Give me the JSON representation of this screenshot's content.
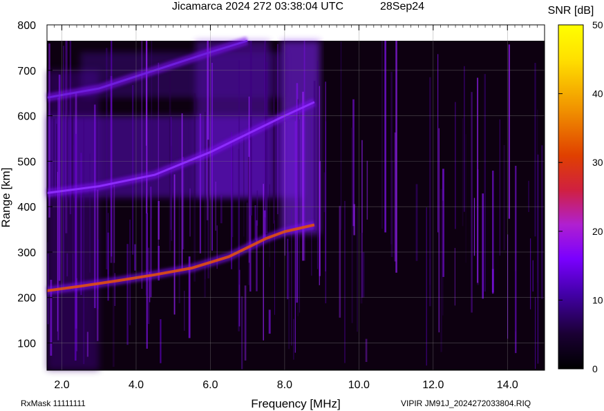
{
  "header": {
    "title": "Jicamarca 2024 272 03:38:04 UTC",
    "date": "28Sep24"
  },
  "footer": {
    "left": "RxMask 11111111",
    "right": "VIPIR  JM91J_2024272033804.RIQ"
  },
  "chart_data": {
    "type": "heatmap",
    "title": "Jicamarca 2024 272 03:38:04 UTC",
    "xlabel": "Frequency [MHz]",
    "ylabel": "Range [km]",
    "xlim": [
      1.6,
      15.0
    ],
    "ylim": [
      40,
      800
    ],
    "data_range_top_km": 765,
    "xticks": [
      "2.0",
      "4.0",
      "6.0",
      "8.0",
      "10.0",
      "12.0",
      "14.0"
    ],
    "yticks": [
      "100",
      "200",
      "300",
      "400",
      "500",
      "600",
      "700",
      "800"
    ],
    "grid": true,
    "colorbar": {
      "label": "SNR [dB]",
      "min": 0,
      "max": 50,
      "ticks": [
        "0",
        "10",
        "20",
        "30",
        "40",
        "50"
      ],
      "colors": [
        "#000000",
        "#1a0033",
        "#4400aa",
        "#7a00ff",
        "#b020d0",
        "#d02040",
        "#e04000",
        "#f09000",
        "#ffe000",
        "#ffff00"
      ]
    },
    "traces": [
      {
        "name": "F-layer trace",
        "points": [
          [
            1.6,
            215
          ],
          [
            2.5,
            225
          ],
          [
            3.5,
            237
          ],
          [
            4.5,
            250
          ],
          [
            5.5,
            265
          ],
          [
            6.5,
            290
          ],
          [
            7.0,
            310
          ],
          [
            7.5,
            330
          ],
          [
            8.0,
            345
          ],
          [
            8.8,
            360
          ]
        ],
        "snr": 30
      },
      {
        "name": "2F trace",
        "points": [
          [
            1.6,
            430
          ],
          [
            3.0,
            445
          ],
          [
            4.5,
            470
          ],
          [
            6.0,
            520
          ],
          [
            7.0,
            560
          ],
          [
            8.0,
            600
          ],
          [
            8.8,
            630
          ]
        ],
        "snr": 15
      },
      {
        "name": "3F trace",
        "points": [
          [
            1.6,
            640
          ],
          [
            3.0,
            660
          ],
          [
            4.5,
            700
          ],
          [
            6.0,
            740
          ],
          [
            7.0,
            765
          ]
        ],
        "snr": 12
      }
    ]
  }
}
